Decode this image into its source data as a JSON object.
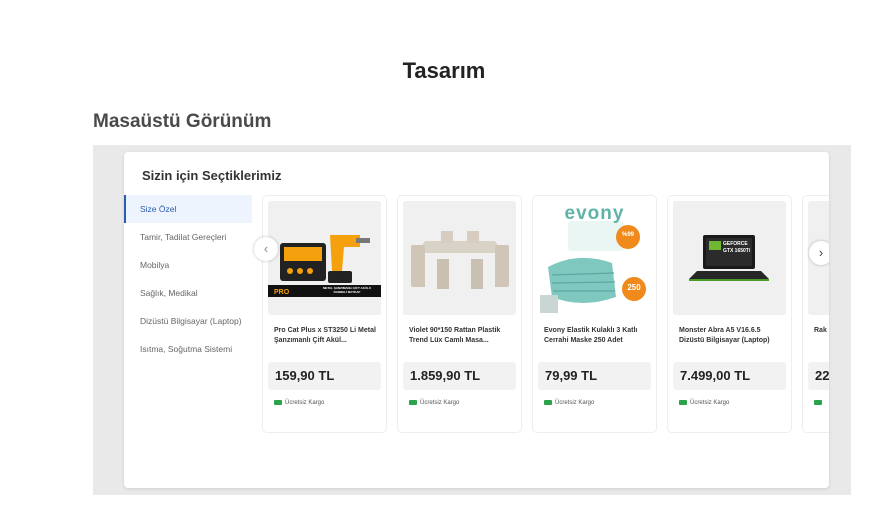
{
  "heading": "Tasarım",
  "subheading": "Masaüstü Görünüm",
  "widget": {
    "title": "Sizin için Seçtiklerimiz",
    "categories": [
      {
        "label": "Size Özel"
      },
      {
        "label": "Tamir, Tadilat Gereçleri"
      },
      {
        "label": "Mobilya"
      },
      {
        "label": "Sağlık, Medikal"
      },
      {
        "label": "Dizüstü Bilgisayar (Laptop)"
      },
      {
        "label": "Isıtma, Soğutma Sistemi"
      }
    ],
    "active_category": "Size Özel",
    "products": [
      {
        "name": "Pro Cat Plus x ST3250 Li Metal Şanzımanlı Çift Akül...",
        "price": "159,90 TL",
        "cargo": "Ücretsiz Kargo",
        "image_text": "METAL ŞANZIMANLI ÇİFT AKÜLÜ DARBELİ MATKAP"
      },
      {
        "name": "Violet 90*150 Rattan Plastik Trend Lüx Camlı Masa...",
        "price": "1.859,90 TL",
        "cargo": "Ücretsiz Kargo"
      },
      {
        "name": "Evony Elastik Kulaklı 3 Katlı Cerrahi Maske 250 Adet",
        "price": "79,99 TL",
        "cargo": "Ücretsiz Kargo",
        "image_text": "evony",
        "badge_small": "%99",
        "badge": "250"
      },
      {
        "name": "Monster Abra A5 V16.6.5 Dizüstü Bilgisayar (Laptop)",
        "price": "7.499,00 TL",
        "cargo": "Ücretsiz Kargo",
        "image_text": "GEFORCE GTX 1650Ti"
      },
      {
        "name": "Rak",
        "price": "22",
        "cargo": ""
      }
    ]
  },
  "icons": {
    "prev": "chevron-left-icon",
    "next": "chevron-right-icon",
    "cargo": "truck-icon"
  },
  "colors": {
    "accent": "#2a5db0",
    "cargo_green": "#2ca24d",
    "mask_teal": "#7fc8c0",
    "drill_yellow": "#f5a10d"
  }
}
